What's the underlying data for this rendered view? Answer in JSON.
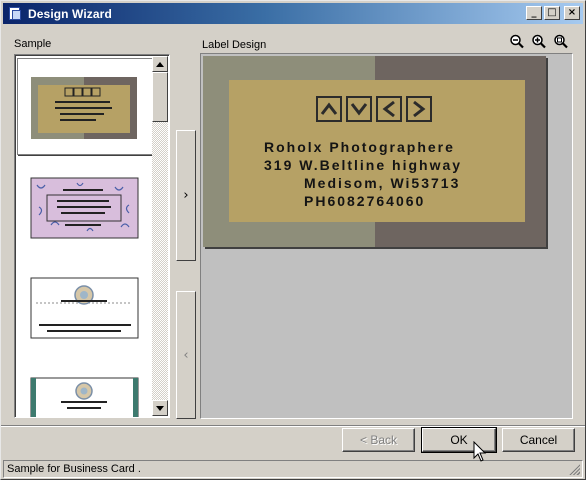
{
  "window": {
    "title": "Design Wizard"
  },
  "titlebar_buttons": [
    {
      "name": "minimize-button",
      "glyph": "_"
    },
    {
      "name": "maximize-button",
      "glyph": "□"
    },
    {
      "name": "close-button",
      "glyph": "×"
    }
  ],
  "labels": {
    "sample": "Sample",
    "label_design": "Label Design"
  },
  "zoom_icons": [
    "zoom-out-icon",
    "zoom-in-icon",
    "zoom-fit-icon"
  ],
  "nav": {
    "next_glyph": "›",
    "prev_glyph": "‹"
  },
  "samples": [
    {
      "selected": true,
      "style": "photo-tan",
      "lines": [
        "Roholx Photographere",
        "319 W.Beltline highway",
        "Medisom, Wi53713",
        "PH6082764060"
      ]
    },
    {
      "selected": false,
      "style": "floral-pink"
    },
    {
      "selected": false,
      "style": "white-emblem"
    },
    {
      "selected": false,
      "style": "teal-emblem"
    }
  ],
  "card": {
    "lines": [
      "Roholx Photographere",
      "319 W.Beltline highway",
      "Medisom, Wi53713",
      "PH6082764060"
    ],
    "arrow_icons": [
      "arrow-up-icon",
      "arrow-down-icon",
      "arrow-left-icon",
      "arrow-right-icon"
    ],
    "colors": {
      "left": "#8e8e7a",
      "right": "#6e6560",
      "inner": "#b6a165"
    }
  },
  "buttons": {
    "back": "< Back",
    "ok": "OK",
    "cancel": "Cancel"
  },
  "status": {
    "text": "Sample for Business Card ."
  }
}
